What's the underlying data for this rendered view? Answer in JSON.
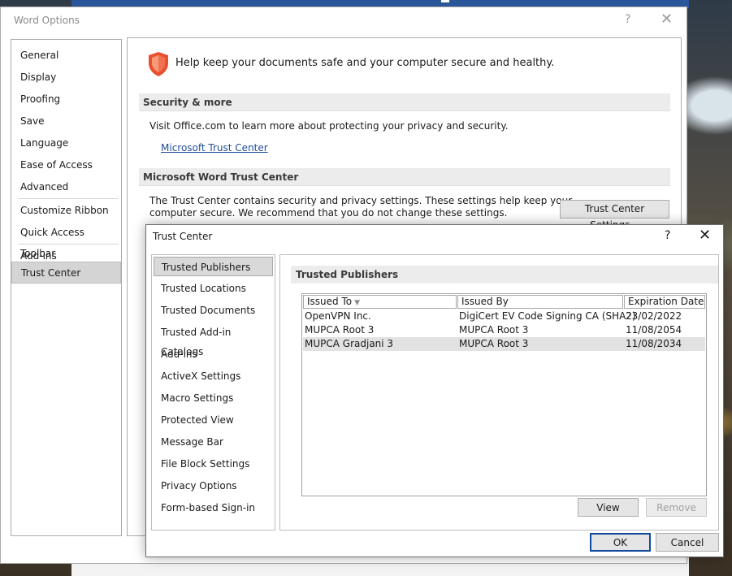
{
  "word_options": {
    "title": "Word Options",
    "help_glyph": "?",
    "close_glyph": "✕",
    "nav_groups": [
      [
        "General",
        "Display",
        "Proofing",
        "Save",
        "Language",
        "Ease of Access",
        "Advanced"
      ],
      [
        "Customize Ribbon",
        "Quick Access Toolbar"
      ],
      [
        "Add-ins",
        "Trust Center"
      ]
    ],
    "selected_nav": "Trust Center",
    "intro_text": "Help keep your documents safe and your computer secure and healthy.",
    "security_section": {
      "header": "Security & more",
      "text": "Visit Office.com to learn more about protecting your privacy and security.",
      "link": "Microsoft Trust Center"
    },
    "trust_center_section": {
      "header": "Microsoft Word Trust Center",
      "text_line1": "The Trust Center contains security and privacy settings. These settings help keep your",
      "text_line2": "computer secure. We recommend that you do not change these settings.",
      "button": "Trust Center Settings..."
    }
  },
  "trust_center": {
    "title": "Trust Center",
    "help_glyph": "?",
    "close_glyph": "✕",
    "nav": [
      "Trusted Publishers",
      "Trusted Locations",
      "Trusted Documents",
      "Trusted Add-in Catalogs",
      "Add-ins",
      "ActiveX Settings",
      "Macro Settings",
      "Protected View",
      "Message Bar",
      "File Block Settings",
      "Privacy Options",
      "Form-based Sign-in"
    ],
    "selected_nav": "Trusted Publishers",
    "panel_header": "Trusted Publishers",
    "columns": [
      "Issued To",
      "Issued By",
      "Expiration Date"
    ],
    "publishers": [
      {
        "issued_to": "OpenVPN Inc.",
        "issued_by": "DigiCert EV Code Signing CA (SHA2)",
        "expiration": "23/02/2022",
        "selected": false
      },
      {
        "issued_to": "MUPCA Root 3",
        "issued_by": "MUPCA Root 3",
        "expiration": "11/08/2054",
        "selected": false
      },
      {
        "issued_to": "MUPCA Gradjani 3",
        "issued_by": "MUPCA Root 3",
        "expiration": "11/08/2034",
        "selected": true
      }
    ],
    "view_button": "View",
    "remove_button": "Remove",
    "ok_button": "OK",
    "cancel_button": "Cancel"
  },
  "colors": {
    "word_blue": "#2b579a",
    "shield_orange": "#e9502f",
    "link_blue": "#1f4e99",
    "ok_border": "#0f4a9e"
  }
}
